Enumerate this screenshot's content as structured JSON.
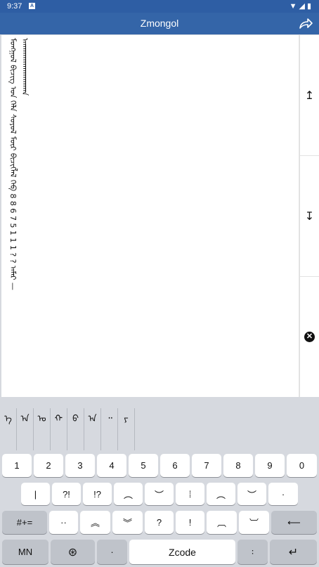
{
  "status": {
    "time": "9:37",
    "badge": "A",
    "icons": "▼◢▮"
  },
  "appbar": {
    "title": "Zmongol",
    "share_icon": "share-icon"
  },
  "editor": {
    "col1": "ᠮᠣᠩᠭᠣᠯ ᠪᠢᠴᠢᠭ ᠤᠨ ᠬᠡᠯᠡ ᠰᠣᠶᠣᠯ ᠮᠥᠷ ᠪᠢᠴᠢᠭᠯᠡᠯ ᠬᠡᠪ 8 8 6 7 5 1 1 1  ? ? ᠠᠮᠠᠷ —",
    "col2": "ᠠᠠᠠᠠᠠᠠᠠᠠᠠᠠᠠᠠᠠᠠᠠᠠᠠᠠᠠᠠᠠᠠᠠᠠ"
  },
  "tools": {
    "up_icon": "↥",
    "down_icon": "↧",
    "clear_icon": "✕"
  },
  "candidates": [
    "ᠡ",
    "ᠠ",
    "ᠣ",
    "ᠬ",
    "ᠪ",
    "ᠠ",
    "᠃",
    "ᠶ"
  ],
  "keyboard": {
    "row1": [
      "1",
      "2",
      "3",
      "4",
      "5",
      "6",
      "7",
      "8",
      "9",
      "0"
    ],
    "row2": [
      "|",
      "?!",
      "!?",
      "︵",
      "︶",
      "⁞",
      "︵",
      "︶",
      "·"
    ],
    "row3": [
      "#+=",
      "··",
      "︽",
      "︾",
      "?",
      "!",
      "︹",
      "︺",
      "⟵"
    ],
    "row4": {
      "mn": "MN",
      "globe": "⊛",
      "dot": "·",
      "space": "Zcode",
      "colon": "꞉",
      "enter": "↵"
    }
  }
}
